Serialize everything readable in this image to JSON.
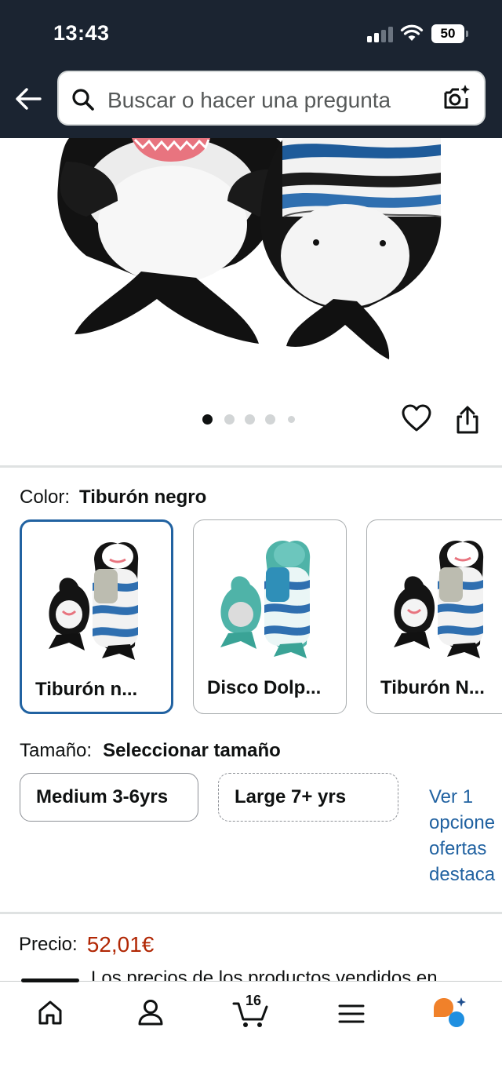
{
  "status_bar": {
    "time": "13:43",
    "battery": "50"
  },
  "header": {
    "search_placeholder": "Buscar o hacer una pregunta"
  },
  "gallery": {
    "image_count": 5,
    "active_index": 0
  },
  "color": {
    "label": "Color:",
    "selected": "Tiburón negro",
    "options": [
      {
        "label": "Tiburón n..."
      },
      {
        "label": "Disco Dolp..."
      },
      {
        "label": "Tiburón N..."
      }
    ]
  },
  "size": {
    "label": "Tamaño:",
    "selected": "Seleccionar tamaño",
    "options": [
      {
        "label": "Medium 3-6yrs"
      },
      {
        "label": "Large 7+ yrs"
      }
    ],
    "offers_link": [
      "Ver 1",
      "opcione",
      "ofertas",
      "destaca"
    ]
  },
  "price": {
    "label": "Precio:",
    "value": "52,01€",
    "note": "Los precios de los productos vendidos en"
  },
  "bottom_nav": {
    "cart_count": "16",
    "items": [
      "home-icon",
      "account-icon",
      "cart-icon",
      "menu-icon",
      "rufus-icon"
    ]
  },
  "colors": {
    "header_bg": "#1b2431",
    "link": "#2162a1",
    "price": "#b12704",
    "selected_border": "#2162a1"
  }
}
